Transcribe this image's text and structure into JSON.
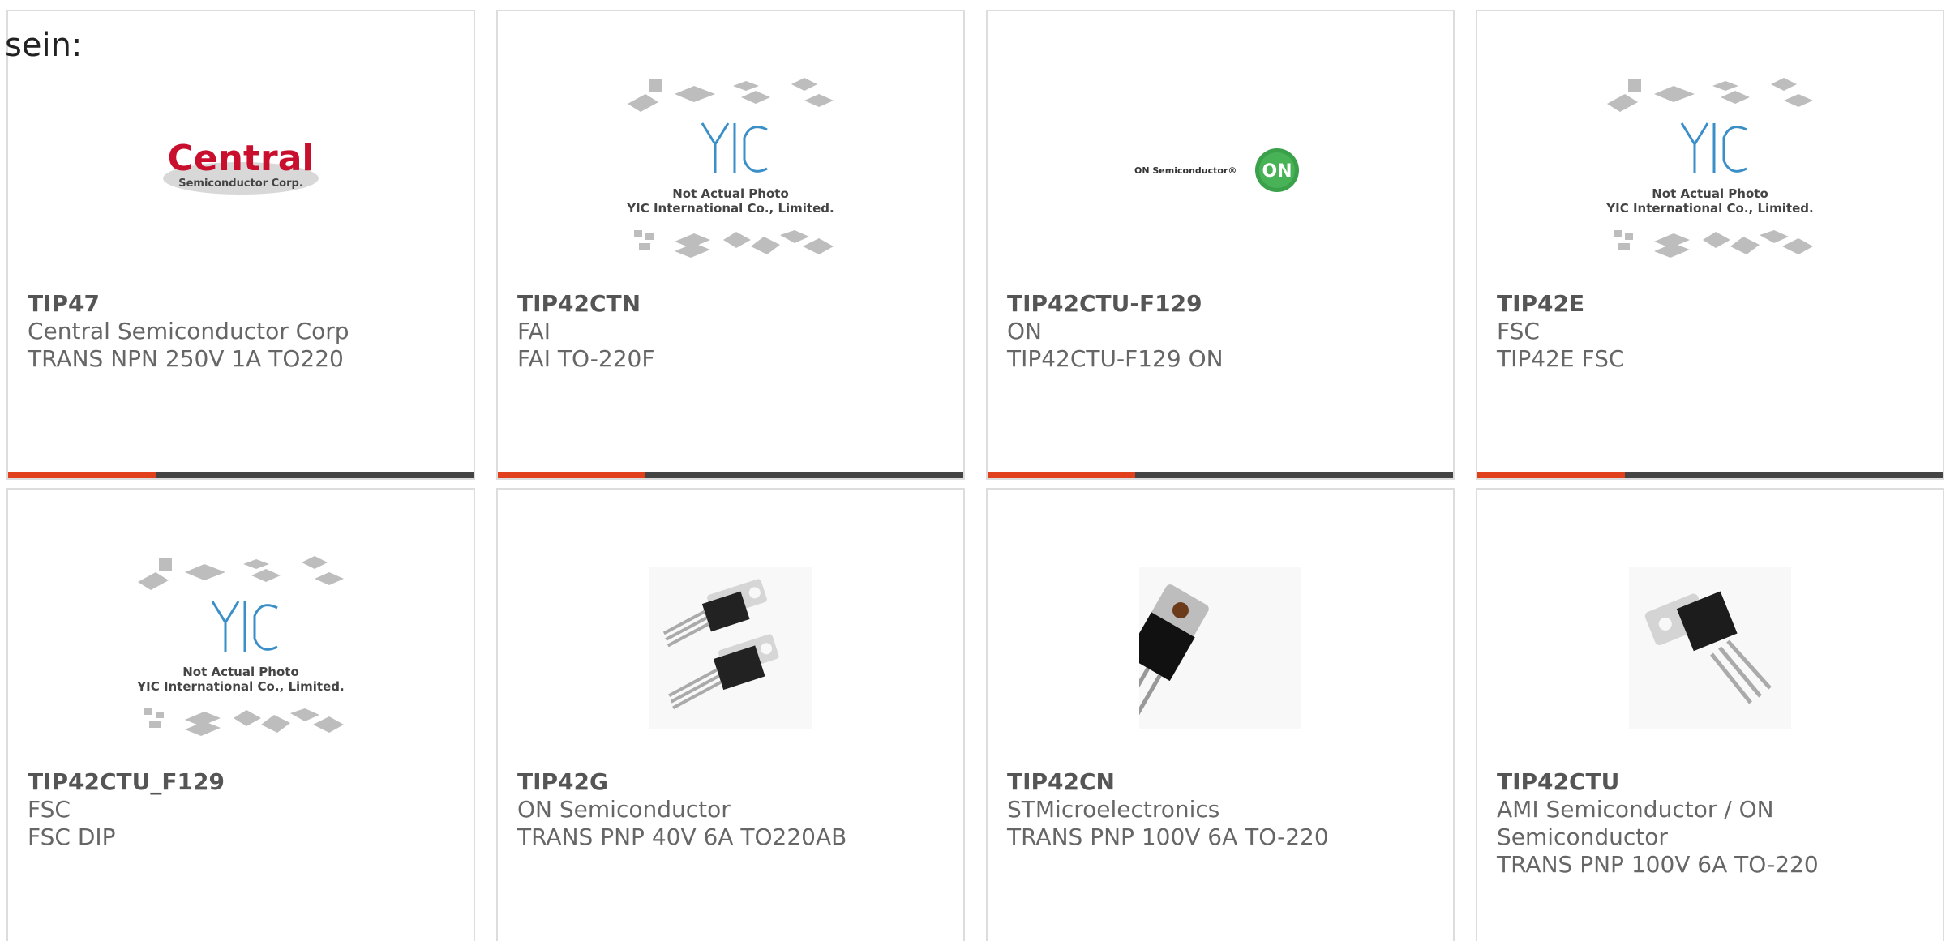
{
  "intro_text": "sein:",
  "colors": {
    "accent": "#e0401c",
    "bar": "#444444",
    "border": "#dddddd",
    "yic_blue": "#3a8fc8"
  },
  "products": [
    {
      "part": "TIP47",
      "maker": "Central Semiconductor Corp",
      "desc": "TRANS NPN 250V 1A TO220",
      "image": "central-logo",
      "logo_text_1": "Central",
      "logo_text_2": "Semiconductor Corp."
    },
    {
      "part": "TIP42CTN",
      "maker": "FAI",
      "desc": "FAI TO-220F",
      "image": "yic-placeholder",
      "note_1": "Not Actual Photo",
      "note_2": "YIC International Co., Limited."
    },
    {
      "part": "TIP42CTU-F129",
      "maker": "ON",
      "desc": "TIP42CTU-F129 ON",
      "image": "on-semi-logo",
      "logo_text_1": "ON Semiconductor®",
      "logo_text_2": "ON"
    },
    {
      "part": "TIP42E",
      "maker": "FSC",
      "desc": "TIP42E FSC",
      "image": "yic-placeholder",
      "note_1": "Not Actual Photo",
      "note_2": "YIC International Co., Limited."
    },
    {
      "part": "TIP42CTU_F129",
      "maker": "FSC",
      "desc": "FSC DIP",
      "image": "yic-placeholder",
      "note_1": "Not Actual Photo",
      "note_2": "YIC International Co., Limited."
    },
    {
      "part": "TIP42G",
      "maker": "ON Semiconductor",
      "desc": "TRANS PNP 40V 6A TO220AB",
      "image": "to220-pair"
    },
    {
      "part": "TIP42CN",
      "maker": "STMicroelectronics",
      "desc": "TRANS PNP 100V 6A TO-220",
      "image": "to220-single-angled"
    },
    {
      "part": "TIP42CTU",
      "maker": "AMI Semiconductor / ON Semiconductor",
      "desc": "TRANS PNP 100V 6A TO-220",
      "image": "to220-single"
    }
  ]
}
